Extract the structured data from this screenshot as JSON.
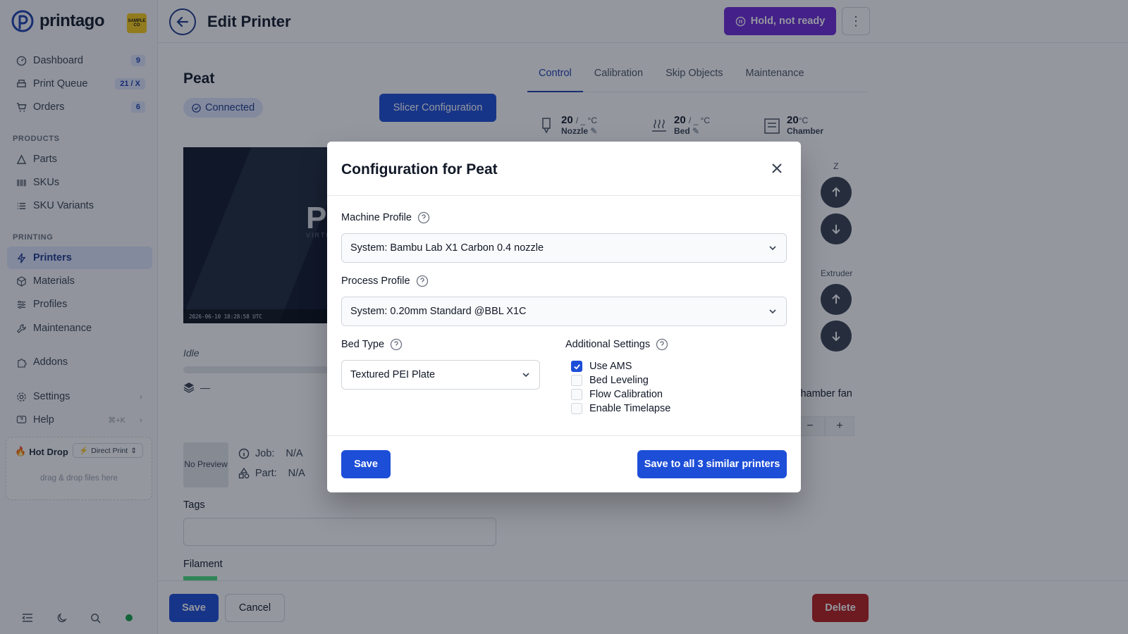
{
  "brand": {
    "name": "printago",
    "org_badge": "SAMPLE CO"
  },
  "sidebar": {
    "top_items": [
      {
        "label": "Dashboard",
        "badge": "9"
      },
      {
        "label": "Print Queue",
        "badge": "21 / X"
      },
      {
        "label": "Orders",
        "badge": "6"
      }
    ],
    "products_label": "PRODUCTS",
    "products_items": [
      {
        "label": "Parts"
      },
      {
        "label": "SKUs"
      },
      {
        "label": "SKU Variants"
      }
    ],
    "printing_label": "PRINTING",
    "printing_items": [
      {
        "label": "Printers",
        "active": true
      },
      {
        "label": "Materials"
      },
      {
        "label": "Profiles"
      },
      {
        "label": "Maintenance"
      }
    ],
    "addons_label": "Addons",
    "settings_label": "Settings",
    "help_label": "Help",
    "help_shortcut": "⌘+K",
    "hot_drop": {
      "title": "Hot Drop",
      "mode": "Direct Print",
      "hint": "drag & drop files here"
    }
  },
  "header": {
    "title": "Edit Printer",
    "status_button": "Hold, not ready"
  },
  "printer": {
    "name": "Peat",
    "connection": "Connected",
    "slicer_button": "Slicer Configuration",
    "camera_letter": "P",
    "camera_sub": "VIRTU",
    "camera_timestamp": "2026-06-10 18:28:58 UTC",
    "state": "Idle",
    "layers": "—",
    "preview": "No Preview",
    "job_label": "Job:",
    "job_value": "N/A",
    "part_label": "Part:",
    "part_value": "N/A",
    "tags_label": "Tags",
    "filament_label": "Filament"
  },
  "tabs": [
    "Control",
    "Calibration",
    "Skip Objects",
    "Maintenance"
  ],
  "temps": {
    "nozzle": {
      "value": "20",
      "target": "/ _ °C",
      "label": "Nozzle"
    },
    "bed": {
      "value": "20",
      "target": "/ _ °C",
      "label": "Bed"
    },
    "chamber": {
      "value": "20",
      "unit": "°C",
      "label": "Chamber"
    }
  },
  "axis": {
    "z": "Z",
    "extruder": "Extruder"
  },
  "fan": {
    "label": "Chamber fan",
    "minus": "−",
    "plus": "+"
  },
  "footer": {
    "save": "Save",
    "cancel": "Cancel",
    "delete": "Delete"
  },
  "modal": {
    "title": "Configuration for Peat",
    "machine_profile_label": "Machine Profile",
    "machine_profile_value": "System: Bambu Lab X1 Carbon 0.4 nozzle",
    "process_profile_label": "Process Profile",
    "process_profile_value": "System: 0.20mm Standard @BBL X1C",
    "bed_type_label": "Bed Type",
    "bed_type_value": "Textured PEI Plate",
    "additional_label": "Additional Settings",
    "options": [
      {
        "label": "Use AMS",
        "checked": true
      },
      {
        "label": "Bed Leveling",
        "checked": false
      },
      {
        "label": "Flow Calibration",
        "checked": false
      },
      {
        "label": "Enable Timelapse",
        "checked": false
      }
    ],
    "save": "Save",
    "save_all": "Save to all 3 similar printers"
  },
  "colors": {
    "primary": "#1d4ed8",
    "hold": "#6d28d9",
    "danger": "#b91c1c",
    "status_online": "#16a34a"
  }
}
